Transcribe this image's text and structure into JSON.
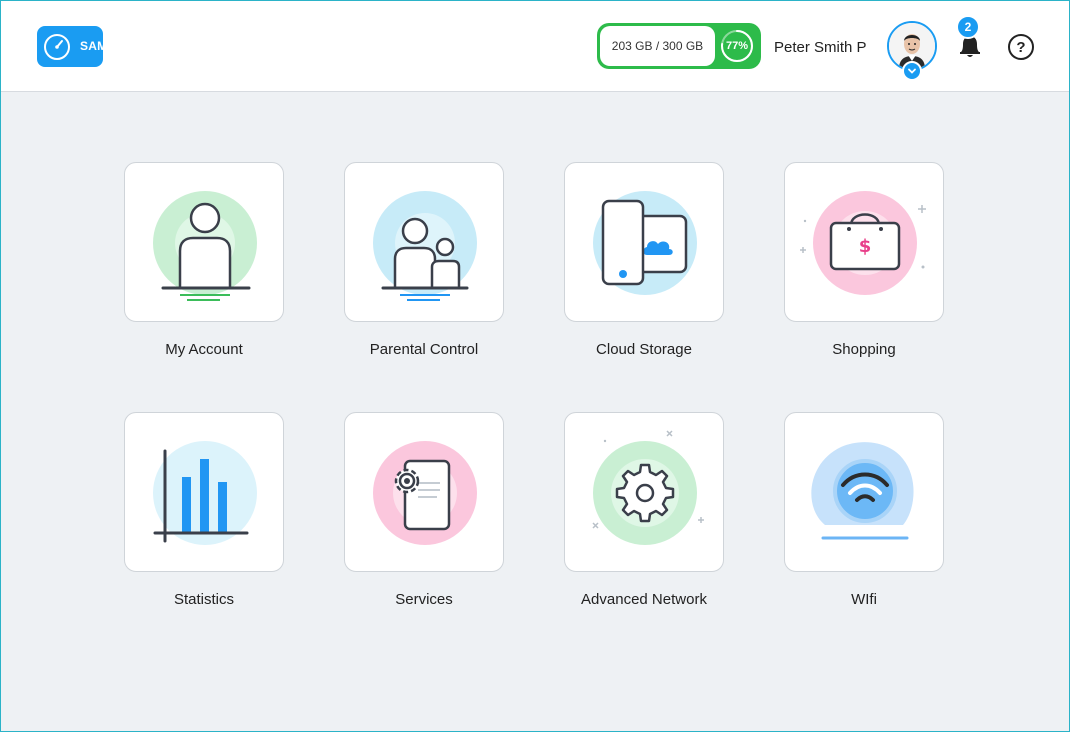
{
  "header": {
    "logo_text": "SAMPLE",
    "storage": {
      "used_label": "203 GB / 300 GB",
      "percent_label": "77%",
      "percent": 77
    },
    "user_name": "Peter Smith P",
    "notifications_count": "2",
    "help_label": "?"
  },
  "tiles": [
    {
      "label": "My Account",
      "icon": "account-icon"
    },
    {
      "label": "Parental Control",
      "icon": "parental-control-icon"
    },
    {
      "label": "Cloud Storage",
      "icon": "cloud-storage-icon"
    },
    {
      "label": "Shopping",
      "icon": "shopping-bag-icon"
    },
    {
      "label": "Statistics",
      "icon": "bar-chart-icon"
    },
    {
      "label": "Services",
      "icon": "services-gear-document-icon"
    },
    {
      "label": "Advanced Network",
      "icon": "gear-icon"
    },
    {
      "label": "WIfi",
      "icon": "wifi-icon"
    }
  ],
  "colors": {
    "accent": "#1a9cf2",
    "storage_green": "#2dbb4a",
    "background": "#eef1f4"
  }
}
